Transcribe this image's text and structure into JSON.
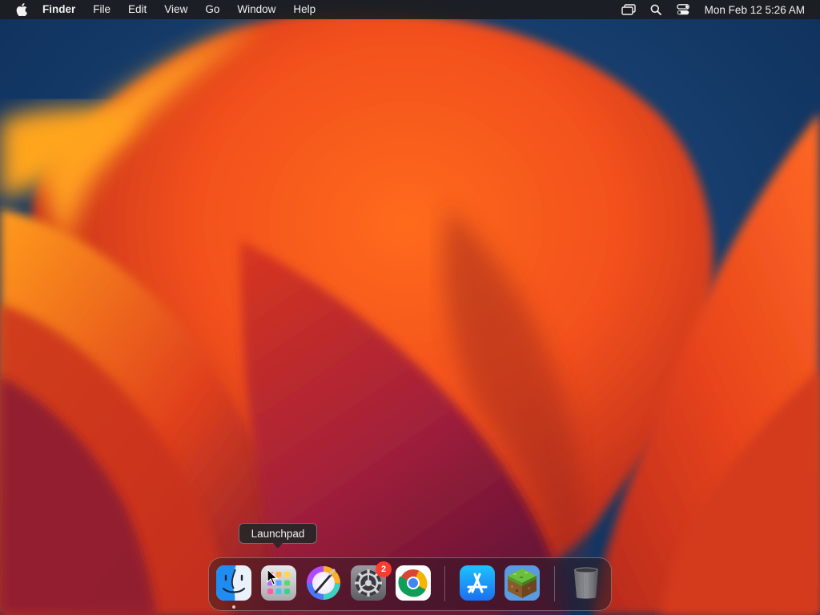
{
  "menubar": {
    "apple_icon": "apple-logo-icon",
    "app_name": "Finder",
    "menus": [
      "File",
      "Edit",
      "View",
      "Go",
      "Window",
      "Help"
    ],
    "status_icons": [
      "screen-mirroring-icon",
      "search-icon",
      "control-center-icon"
    ],
    "clock": "Mon Feb 12  5:26 AM"
  },
  "tooltip": {
    "text": "Launchpad"
  },
  "dock": {
    "apps": [
      {
        "name": "Finder",
        "icon": "finder-icon",
        "running": true
      },
      {
        "name": "Launchpad",
        "icon": "launchpad-icon",
        "running": false
      },
      {
        "name": "Pixelmator",
        "icon": "color-brush-icon",
        "running": false
      },
      {
        "name": "System Settings",
        "icon": "gear-icon",
        "running": false,
        "badge": "2"
      },
      {
        "name": "Google Chrome",
        "icon": "chrome-icon",
        "running": false
      }
    ],
    "extras": [
      {
        "name": "App Store",
        "icon": "app-store-icon"
      },
      {
        "name": "Minecraft",
        "icon": "grass-block-icon"
      }
    ],
    "trash": {
      "name": "Trash",
      "icon": "trash-icon"
    }
  },
  "colors": {
    "menubar_bg": "#1c1c1e",
    "badge": "#ff3b30",
    "wallpaper_orange": "#f25a1a",
    "wallpaper_blue": "#123a66"
  }
}
